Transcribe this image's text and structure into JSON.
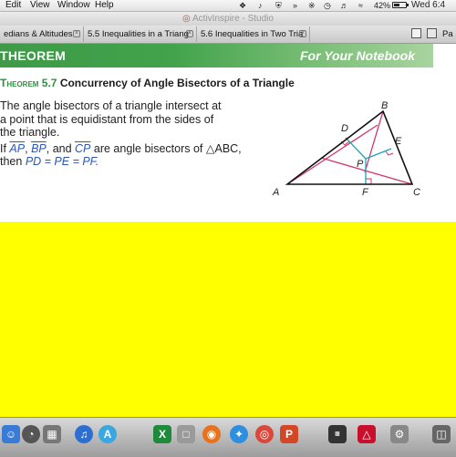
{
  "menubar": {
    "items": [
      "Edit",
      "View",
      "Window",
      "Help"
    ],
    "battery": "42%",
    "clock": "Wed 6:4"
  },
  "window": {
    "title": "ActivInspire - Studio"
  },
  "tabs": [
    {
      "label": "edians & Altitudes"
    },
    {
      "label": "5.5 Inequalities in a Triang"
    },
    {
      "label": "5.6 Inequalities in Two Tria"
    }
  ],
  "toolbar": {
    "label": "Pa"
  },
  "theorem": {
    "band_label": "THEOREM",
    "band_right": "For Your Notebook",
    "number": "Theorem 5.7",
    "title": "Concurrency of Angle Bisectors of a Triangle",
    "text_lines": [
      "The angle bisectors of a triangle intersect at",
      "a point that is equidistant from the sides of",
      "the triangle."
    ],
    "if_prefix": "If ",
    "seg1": "AP",
    "sep1": ", ",
    "seg2": "BP",
    "sep2": ", and ",
    "seg3": "CP",
    "if_suffix": " are angle bisectors of △ABC,",
    "then_prefix": "then ",
    "then_eq": "PD = PE = PF."
  },
  "diagram": {
    "labels": {
      "A": "A",
      "B": "B",
      "C": "C",
      "D": "D",
      "E": "E",
      "F": "F",
      "P": "P"
    },
    "colors": {
      "triangle": "#111111",
      "bisector": "#d6336c",
      "perpendicular": "#1aa5b8"
    }
  },
  "dock": {
    "icons": [
      "finder-icon",
      "dashboard-icon",
      "mission-control-icon",
      "itunes-icon",
      "app-store-icon",
      "excel-icon",
      "preview-icon",
      "firefox-icon",
      "safari-icon",
      "chrome-icon",
      "powerpoint-icon",
      "console-icon",
      "acrobat-icon",
      "system-icon",
      "trash-icon"
    ],
    "colors": [
      "#3a7bd5",
      "#555555",
      "#777777",
      "#2d6fd1",
      "#3aa7e0",
      "#1f8a3c",
      "#9a9a9a",
      "#e8721c",
      "#2e8fe0",
      "#d9483b",
      "#d24726",
      "#333333",
      "#c8102e",
      "#888888",
      "#666666"
    ]
  }
}
